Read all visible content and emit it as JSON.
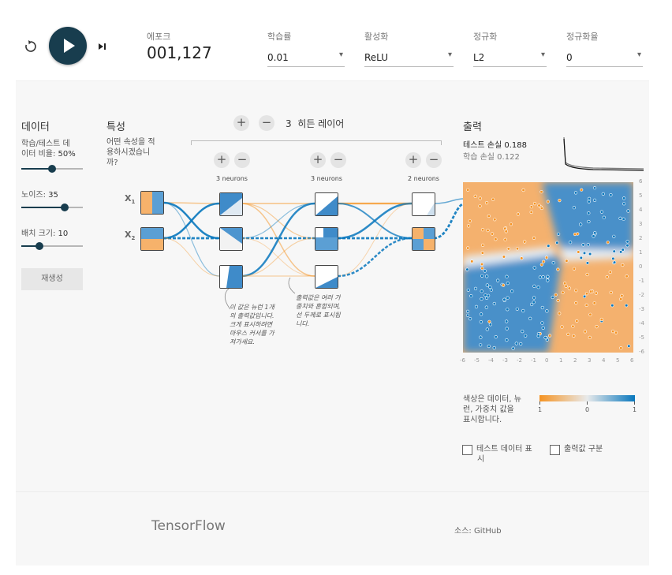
{
  "controls": {
    "reset_icon": "reset-icon",
    "play_icon": "play-icon",
    "step_icon": "step-icon"
  },
  "topbar": {
    "epoch_label": "에포크",
    "epoch_value": "001,127",
    "learning_rate_label": "학습률",
    "learning_rate_value": "0.01",
    "activation_label": "활성화",
    "activation_value": "ReLU",
    "regularization_label": "정규화",
    "regularization_value": "L2",
    "regularization_rate_label": "정규화율",
    "regularization_rate_value": "0"
  },
  "data_panel": {
    "title": "데이터",
    "ratio_label_line1": "학습/테스트 데",
    "ratio_label_line2": "이터 비율:",
    "ratio_value": "50%",
    "ratio_level": 0.5,
    "noise_label": "노이즈:",
    "noise_value": "35",
    "noise_level": 0.7,
    "batch_label": "배치 크기:",
    "batch_value": "10",
    "batch_level": 0.3,
    "regenerate_label": "재생성"
  },
  "features_panel": {
    "title": "특성",
    "question_line1": "어떤 속성을 적",
    "question_line2": "용하시겠습니",
    "question_line3": "까?",
    "x1_label": "X",
    "x1_sub": "1",
    "x2_label": "X",
    "x2_sub": "2"
  },
  "network": {
    "hidden_count": "3",
    "hidden_label": "히든 레이어",
    "plus": "+",
    "minus": "−",
    "layers": [
      {
        "neurons_label": "3 neurons"
      },
      {
        "neurons_label": "3 neurons"
      },
      {
        "neurons_label": "2 neurons"
      }
    ],
    "annotation1": [
      "이 값은 뉴런 1개",
      "의 출력값입니다.",
      "크게 표시하려면",
      "마우스 커서를 가",
      "져가세요."
    ],
    "annotation2": [
      "출력값은 여러 가",
      "중치와 혼합되며,",
      "선 두께로 표시됩",
      "니다."
    ]
  },
  "output_panel": {
    "title": "출력",
    "test_loss_label": "테스트 손실",
    "test_loss_value": "0.188",
    "train_loss_label": "학습 손실",
    "train_loss_value": "0.122",
    "x_ticks": [
      "-6",
      "-5",
      "-4",
      "-3",
      "-2",
      "-1",
      "0",
      "1",
      "2",
      "3",
      "4",
      "5",
      "6"
    ],
    "y_ticks": [
      "6",
      "5",
      "4",
      "3",
      "2",
      "1",
      "0",
      "-1",
      "-2",
      "-3",
      "-4",
      "-5",
      "-6"
    ],
    "legend_text": [
      "색상은 데이터, 뉴",
      "런, 가중치 값을",
      "표시합니다."
    ],
    "legend_ticks": [
      "1",
      "0",
      "1"
    ],
    "show_test_label": [
      "테스트 데이터 표",
      "시"
    ],
    "discretize_label": "출력값 구분",
    "colors": {
      "orange": "#f59322",
      "blue": "#0877bd",
      "dark": "#183D4E"
    }
  },
  "footer": {
    "brand": "TensorFlow",
    "source": "소스: GitHub"
  }
}
